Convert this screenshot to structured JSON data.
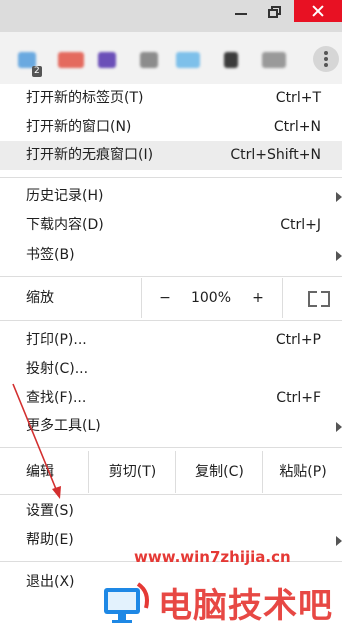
{
  "menu": {
    "new_tab": {
      "label": "打开新的标签页(T)",
      "shortcut": "Ctrl+T"
    },
    "new_window": {
      "label": "打开新的窗口(N)",
      "shortcut": "Ctrl+N"
    },
    "incognito": {
      "label": "打开新的无痕窗口(I)",
      "shortcut": "Ctrl+Shift+N"
    },
    "history": {
      "label": "历史记录(H)"
    },
    "downloads": {
      "label": "下载内容(D)",
      "shortcut": "Ctrl+J"
    },
    "bookmarks": {
      "label": "书签(B)"
    },
    "zoom": {
      "label": "缩放",
      "minus": "−",
      "value": "100%",
      "plus": "+"
    },
    "print": {
      "label": "打印(P)...",
      "shortcut": "Ctrl+P"
    },
    "cast": {
      "label": "投射(C)..."
    },
    "find": {
      "label": "查找(F)...",
      "shortcut": "Ctrl+F"
    },
    "more_tools": {
      "label": "更多工具(L)"
    },
    "edit": {
      "label": "编辑",
      "cut": "剪切(T)",
      "copy": "复制(C)",
      "paste": "粘贴(P)"
    },
    "settings": {
      "label": "设置(S)"
    },
    "help": {
      "label": "帮助(E)"
    },
    "exit": {
      "label": "退出(X)"
    }
  },
  "toolbar": {
    "badge_count": "2"
  },
  "watermark": {
    "url": "www.win7zhijia.cn",
    "brand": "电脑技术吧"
  },
  "colors": {
    "highlight": "#ececec",
    "close_button": "#e81123",
    "annotation_arrow": "#d32f2f",
    "watermark": "#e53935"
  }
}
